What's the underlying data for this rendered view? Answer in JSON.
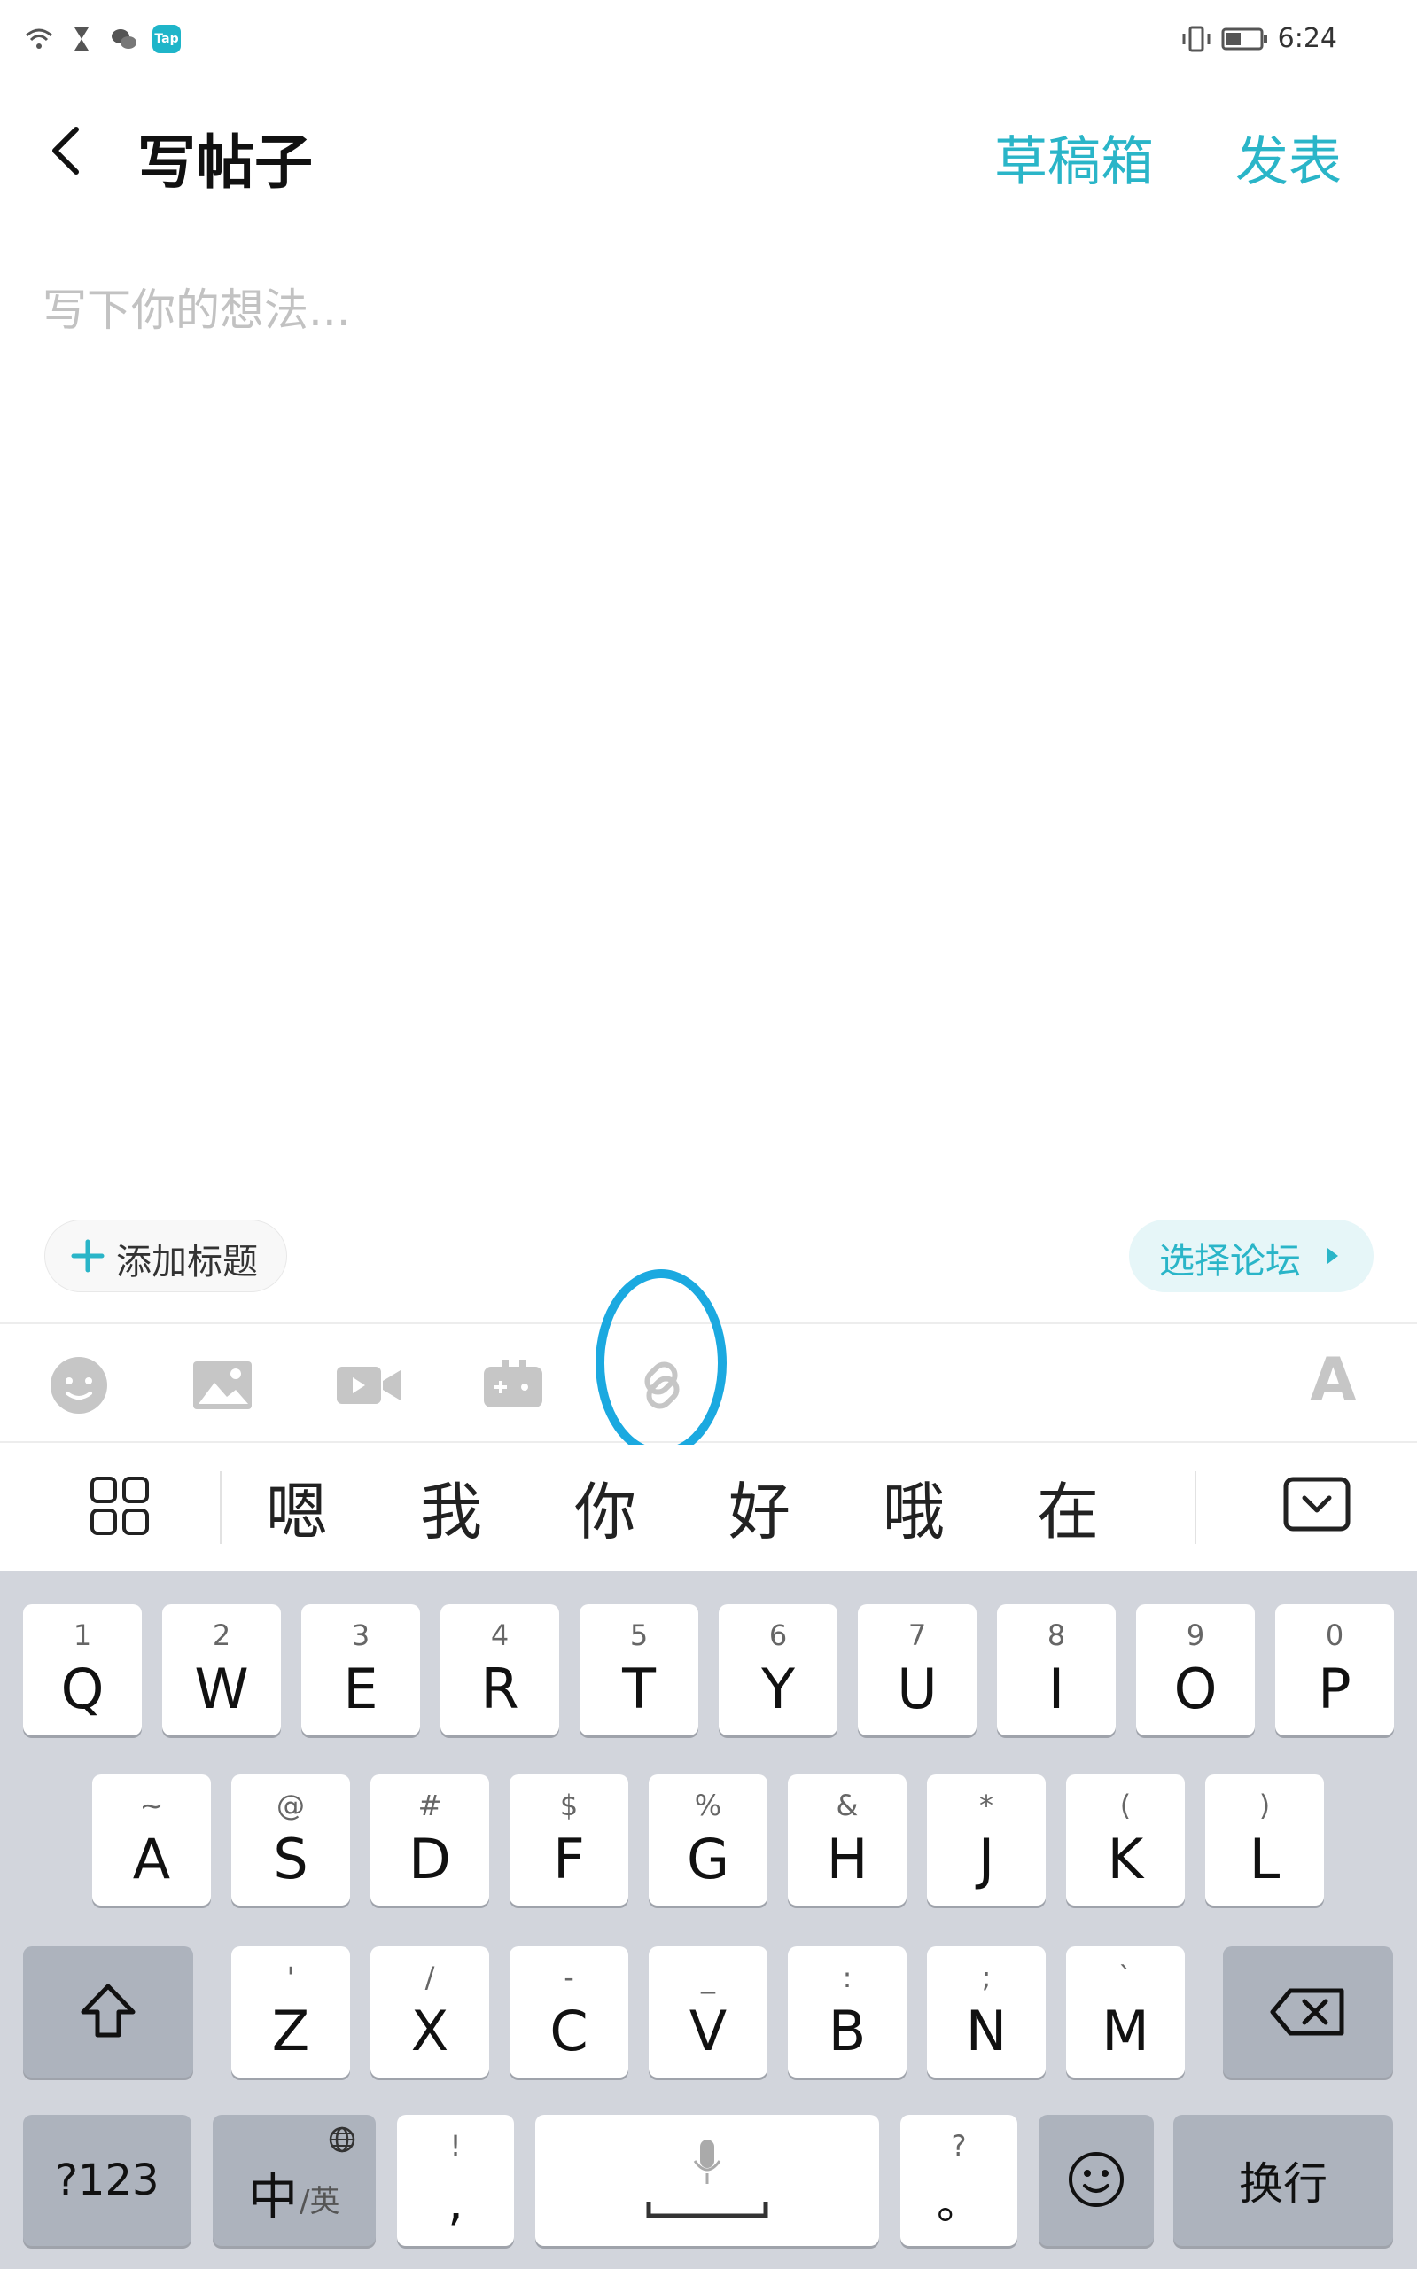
{
  "status_bar": {
    "left_icons": [
      "wifi-icon",
      "hourglass-icon",
      "wechat-icon",
      "taptap-icon"
    ],
    "tap_badge": "Tap",
    "right_icons": [
      "vibrate-icon",
      "battery-icon"
    ],
    "time": "6:24"
  },
  "app_bar": {
    "title": "写帖子",
    "drafts": "草稿箱",
    "publish": "发表",
    "accent_color": "#2ab5c8"
  },
  "editor": {
    "placeholder": "写下你的想法..."
  },
  "chips": {
    "add_title": "添加标题",
    "select_forum": "选择论坛"
  },
  "toolbar": {
    "tools": [
      "emoji-icon",
      "image-icon",
      "video-icon",
      "game-icon",
      "link-icon"
    ],
    "font_label": "A",
    "highlighted_tool": "link-icon",
    "highlight_color": "#1ba9e0"
  },
  "candidates": [
    "嗯",
    "我",
    "你",
    "好",
    "哦",
    "在"
  ],
  "keyboard": {
    "row1": [
      {
        "hint": "1",
        "key": "Q"
      },
      {
        "hint": "2",
        "key": "W"
      },
      {
        "hint": "3",
        "key": "E"
      },
      {
        "hint": "4",
        "key": "R"
      },
      {
        "hint": "5",
        "key": "T"
      },
      {
        "hint": "6",
        "key": "Y"
      },
      {
        "hint": "7",
        "key": "U"
      },
      {
        "hint": "8",
        "key": "I"
      },
      {
        "hint": "9",
        "key": "O"
      },
      {
        "hint": "0",
        "key": "P"
      }
    ],
    "row2": [
      {
        "hint": "~",
        "key": "A"
      },
      {
        "hint": "@",
        "key": "S"
      },
      {
        "hint": "#",
        "key": "D"
      },
      {
        "hint": "$",
        "key": "F"
      },
      {
        "hint": "%",
        "key": "G"
      },
      {
        "hint": "&",
        "key": "H"
      },
      {
        "hint": "*",
        "key": "J"
      },
      {
        "hint": "(",
        "key": "K"
      },
      {
        "hint": ")",
        "key": "L"
      }
    ],
    "row3": [
      {
        "hint": "'",
        "key": "Z"
      },
      {
        "hint": "/",
        "key": "X"
      },
      {
        "hint": "-",
        "key": "C"
      },
      {
        "hint": "_",
        "key": "V"
      },
      {
        "hint": ":",
        "key": "B"
      },
      {
        "hint": ";",
        "key": "N"
      },
      {
        "hint": "`",
        "key": "M"
      }
    ],
    "symbols_key": "?123",
    "lang_key_main": "中",
    "lang_key_sub": "/英",
    "comma_hint": "!",
    "comma_key": ",",
    "period_hint": "?",
    "period_key": "。",
    "enter_key": "换行"
  }
}
